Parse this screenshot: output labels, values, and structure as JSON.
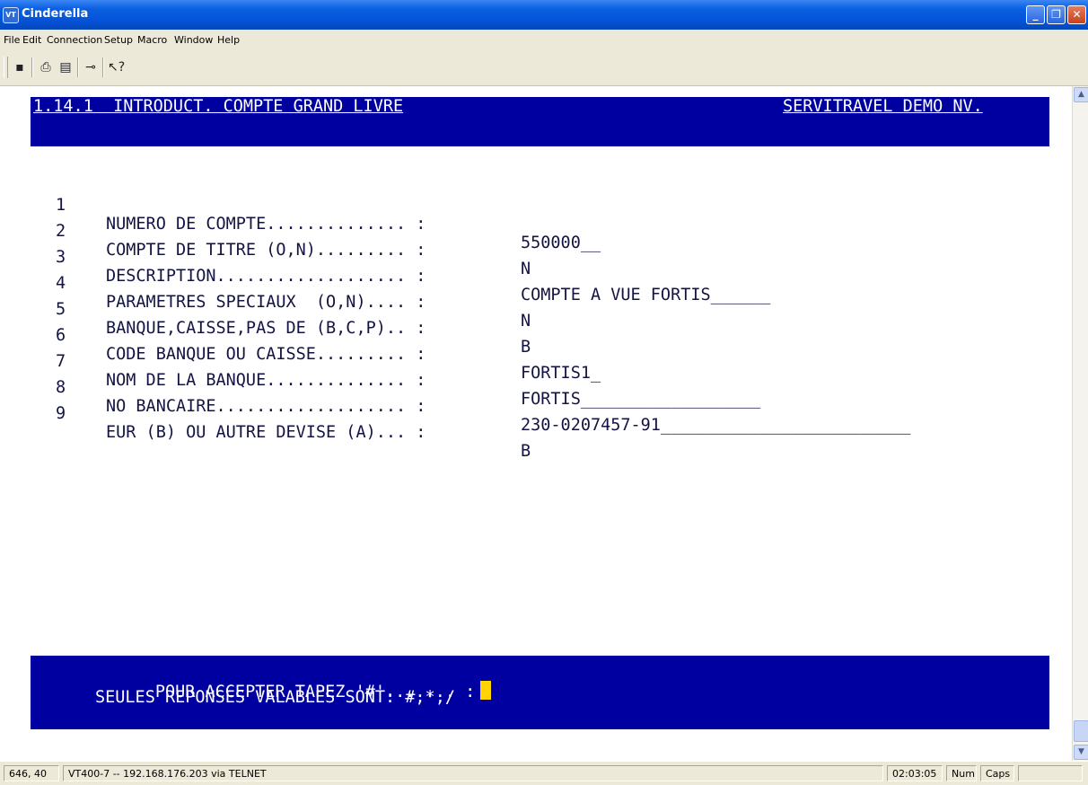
{
  "window": {
    "title": "Cinderella",
    "icon_text": "VT"
  },
  "menu": [
    "File",
    "Edit",
    "Connection",
    "Setup",
    "Macro",
    "Window",
    "Help"
  ],
  "toolbar": [
    "save-icon",
    "print-icon",
    "print-setup-icon",
    "connect-icon",
    "context-help-icon"
  ],
  "terminal": {
    "header_left": "1.14.1  INTRODUCT. COMPTE GRAND LIVRE",
    "header_right": "SERVITRAVEL DEMO NV.",
    "fields": [
      {
        "num": "1",
        "label": "NUMERO DE COMPTE.............. :",
        "value": "550000__"
      },
      {
        "num": "2",
        "label": "COMPTE DE TITRE (O,N)......... :",
        "value": "N"
      },
      {
        "num": "3",
        "label": "DESCRIPTION................... :",
        "value": "COMPTE A VUE FORTIS______"
      },
      {
        "num": "4",
        "label": "PARAMETRES SPECIAUX  (O,N).... :",
        "value": "N"
      },
      {
        "num": "5",
        "label": "BANQUE,CAISSE,PAS DE (B,C,P).. :",
        "value": "B"
      },
      {
        "num": "6",
        "label": "CODE BANQUE OU CAISSE......... :",
        "value": "FORTIS1_"
      },
      {
        "num": "7",
        "label": "NOM DE LA BANQUE.............. :",
        "value": "FORTIS__________________"
      },
      {
        "num": "8",
        "label": "NO BANCAIRE................... :",
        "value": "230-0207457-91_________________________"
      },
      {
        "num": "9",
        "label": "EUR (B) OU AUTRE DEVISE (A)... :",
        "value": "B"
      }
    ],
    "prompt": "POUR ACCEPTER TAPEZ '#'....... :",
    "hint": "SEULES REPONSES VALABLES SONT: #,*,/"
  },
  "status": {
    "cursor_pos": "646, 40",
    "connection": "VT400-7 -- 192.168.176.203 via TELNET",
    "time": "02:03:05",
    "num": "Num",
    "caps": "Caps"
  },
  "colors": {
    "terminal_blue": "#0000a0",
    "cursor": "#ffd400",
    "titlebar": "#0453d9"
  }
}
